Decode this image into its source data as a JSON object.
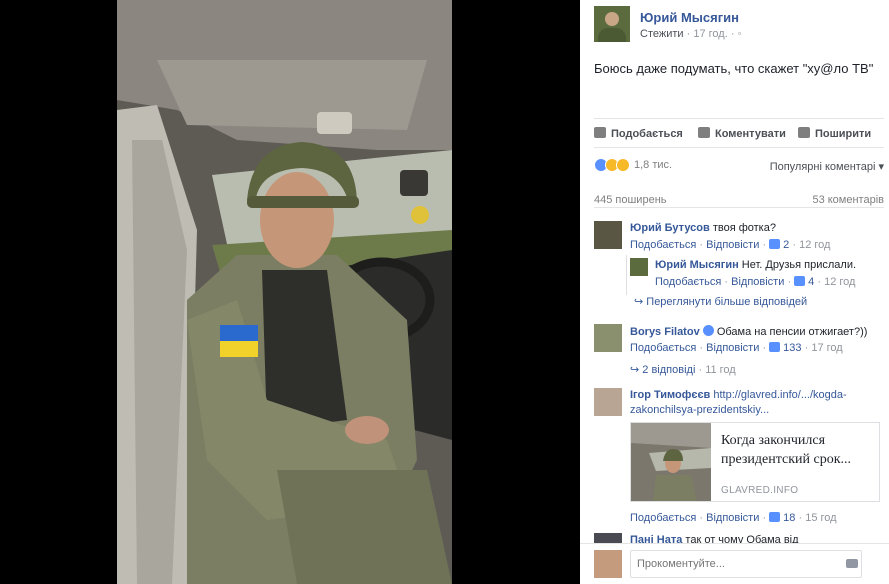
{
  "post": {
    "author": "Юрий Мысягин",
    "follow_label": "Стежити",
    "time": "17 год.",
    "dot": "·",
    "text": "Боюсь даже подумать, что скажет \"ху@ло ТВ\""
  },
  "actions": {
    "like": "Подобається",
    "comment": "Коментувати",
    "share": "Поширити"
  },
  "reactions": {
    "count": "1,8 тис.",
    "sort_label": "Популярні коментарі"
  },
  "stats": {
    "shares": "445 поширень",
    "comments": "53 коментарів"
  },
  "comments": [
    {
      "author": "Юрий Бутусов",
      "text": "твоя фотка?",
      "like": "Подобається",
      "sep": "·",
      "reply": "Відповісти",
      "likes": "2",
      "time": "12 год",
      "replies": [
        {
          "author": "Юрий Мысягин",
          "text": "Нет. Друзья прислали.",
          "like": "Подобається",
          "reply": "Відповісти",
          "likes": "4",
          "time": "12 год"
        }
      ],
      "more": "Переглянути більше відповідей"
    },
    {
      "author": "Borys Filatov",
      "text": "Обама на пенсии отжигает?))",
      "like": "Подобається",
      "reply": "Відповісти",
      "likes": "133",
      "time": "17 год",
      "more": "2 відповіді",
      "more_time": "11 год"
    },
    {
      "author": "Ігор Тимофєєв",
      "link_line1": "http://glavred.info/.../kogda-",
      "link_line2": "zakonchilsya-prezidentskiy...",
      "card": {
        "title": "Когда закончился президентский срок...",
        "domain": "GLAVRED.INFO"
      },
      "like": "Подобається",
      "reply": "Відповісти",
      "likes": "18",
      "time": "15 год"
    },
    {
      "author": "Пані Ната",
      "text": "так от чому Обама від"
    }
  ],
  "composer": {
    "placeholder": "Прокоментуйте..."
  }
}
